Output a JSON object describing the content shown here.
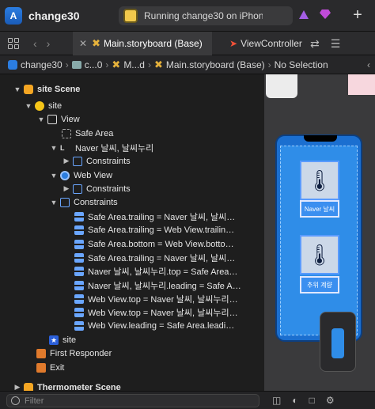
{
  "titlebar": {
    "title": "change30",
    "status": "Running change30 on iPhon…",
    "plus": "+"
  },
  "tabs": {
    "active": "Main.storyboard (Base)",
    "inactive": "ViewController"
  },
  "breadcrumb": {
    "project": "change30",
    "c": "c...0",
    "m": "M...d",
    "file": "Main.storyboard (Base)",
    "selection": "No Selection"
  },
  "outline": {
    "scene1": "site Scene",
    "vc": "site",
    "view": "View",
    "safe_area": "Safe Area",
    "naver_label": "Naver 날씨, 날씨누리",
    "constraints": "Constraints",
    "web_view": "Web View",
    "constraints_label": "Constraints",
    "c1": "Safe Area.trailing = Naver 날씨, 날씨…",
    "c2": "Safe Area.trailing = Web View.trailin…",
    "c3": "Safe Area.bottom = Web View.botto…",
    "c4": "Safe Area.trailing = Naver 날씨, 날씨…",
    "c5": "Naver 날씨, 날씨누리.top = Safe Area…",
    "c6": "Naver 날씨, 날씨누리.leading = Safe A…",
    "c7": "Web View.top = Naver 날씨, 날씨누리…",
    "c8": "Web View.top = Naver 날씨, 날씨누리…",
    "c9": "Web View.leading = Safe Area.leadi…",
    "site_star": "site",
    "first_responder": "First Responder",
    "exit": "Exit",
    "scene2": "Thermometer Scene"
  },
  "canvas": {
    "label1": "Naver 날씨",
    "label2": "추위 계량"
  },
  "filter": {
    "placeholder": "Filter"
  },
  "colors": {
    "accent": "#2b7de1",
    "scene": "#f5a623",
    "phone": "#2f8de8"
  }
}
